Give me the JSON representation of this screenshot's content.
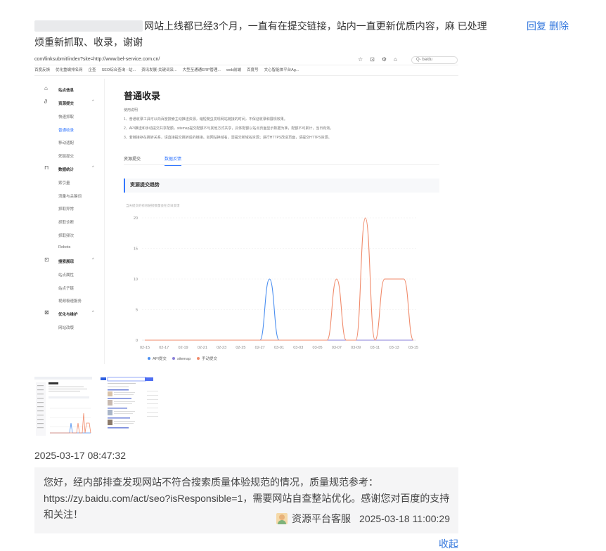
{
  "question": {
    "text": "网站上线都已经3个月，一直有在提交链接，站内一直更新优质内容，麻 已处理烦重新抓取、收录，谢谢",
    "reply_label": "回复",
    "delete_label": "删除",
    "time": "2025-03-17 08:47:32"
  },
  "screenshot": {
    "browser": {
      "url": "com/linksubmit/index?site=http://www.bel-service.com.cn/",
      "search_text": "Q- baidu",
      "bookmarks": [
        "百度反馈",
        "优化重编排名网",
        "企查",
        "SEO综合查询 - 站...",
        "资讯发展-关键词采...",
        "大型至通通ERP管理...",
        "web前端",
        "百度号",
        "文心智能体平台Ag..."
      ]
    },
    "sidebar": {
      "groups": [
        {
          "label": "站点信息",
          "icon": "home-icon",
          "items": []
        },
        {
          "label": "资源提交",
          "icon": "link-icon",
          "items": [
            "快速抓取",
            "普通收录",
            "移动适配",
            "死链提交"
          ]
        },
        {
          "label": "数据统计",
          "icon": "chart-icon",
          "items": [
            "索引量",
            "流量与关键词",
            "抓取异常",
            "抓取诊断",
            "抓取频次",
            "Robots"
          ]
        },
        {
          "label": "搜索展现",
          "icon": "search-icon",
          "items": [
            "站点属性",
            "站点子链",
            "视频极速服务"
          ]
        },
        {
          "label": "优化与维护",
          "icon": "tool-icon",
          "items": [
            "网站改版"
          ]
        }
      ],
      "active_item": "普通收录"
    },
    "main": {
      "title": "普通收录",
      "note_label": "使用说明",
      "notes": [
        "1、普通收录工具可以向百度搜索主动推送资源，缩短爬虫发现网站链接的时间，不保证收录和展现效果。",
        "2、API推送和手动提交共享配额，sitemap提交配额不与其他方式共享，具体配额以站点页面显示数据为准，配额不可累计，当日有效。",
        "3、若链接存在跳转关系，请直接提交跳转后的链接。如网站换域名，需提交新域名资源；进行HTTPS改造页面，请提交HTTPS资源。"
      ],
      "tabs": [
        "资源提交",
        "数据反馈"
      ],
      "active_tab": "数据反馈",
      "section_title": "资源提交趋势",
      "sub_caption": "当天提交的有效链接数量会在次日反馈"
    }
  },
  "chart_data": {
    "type": "line",
    "title": "资源提交趋势",
    "x": [
      "02-15",
      "02-16",
      "02-17",
      "02-18",
      "02-19",
      "02-20",
      "02-21",
      "02-22",
      "02-23",
      "02-24",
      "02-25",
      "02-26",
      "02-27",
      "02-28",
      "03-01",
      "03-02",
      "03-03",
      "03-04",
      "03-05",
      "03-06",
      "03-07",
      "03-08",
      "03-09",
      "03-10",
      "03-11",
      "03-12",
      "03-13",
      "03-14",
      "03-15"
    ],
    "x_tick_labels": [
      "02-15",
      "02-17",
      "02-19",
      "02-21",
      "02-23",
      "02-25",
      "02-27",
      "03-01",
      "03-03",
      "03-05",
      "03-07",
      "03-09",
      "03-11",
      "03-13",
      "03-15"
    ],
    "ylim": [
      0,
      20
    ],
    "yticks": [
      0,
      5,
      10,
      15,
      20
    ],
    "grid": true,
    "legend_position": "bottom-left",
    "series": [
      {
        "name": "API提交",
        "color": "#4a8ef0",
        "values": [
          0,
          0,
          0,
          0,
          0,
          0,
          0,
          0,
          0,
          0,
          0,
          0,
          0,
          10,
          0,
          0,
          0,
          0,
          0,
          0,
          0,
          0,
          0,
          0,
          0,
          0,
          0,
          0,
          0
        ]
      },
      {
        "name": "sitemap",
        "color": "#8a7fd8",
        "values": [
          0,
          0,
          0,
          0,
          0,
          0,
          0,
          0,
          0,
          0,
          0,
          0,
          0,
          0,
          0,
          0,
          0,
          0,
          0,
          0,
          0,
          0,
          0,
          0,
          0,
          0,
          0,
          0,
          0
        ]
      },
      {
        "name": "手动提交",
        "color": "#f08a6a",
        "values": [
          0,
          0,
          0,
          0,
          0,
          0,
          0,
          0,
          0,
          0,
          0,
          0,
          0,
          0,
          0,
          0,
          0,
          0,
          0,
          0,
          10,
          0,
          0,
          20,
          0,
          10,
          10,
          10,
          0
        ]
      }
    ]
  },
  "reply": {
    "text": "您好，经内部排查发现网站不符合搜索质量体验规范的情况，质量规范参考：https://zy.baidu.com/act/seo?isResponsible=1，需要网站自查整站优化。感谢您对百度的支持和关注！",
    "service_name": "资源平台客服",
    "time": "2025-03-18 11:00:29"
  },
  "collapse_label": "收起"
}
